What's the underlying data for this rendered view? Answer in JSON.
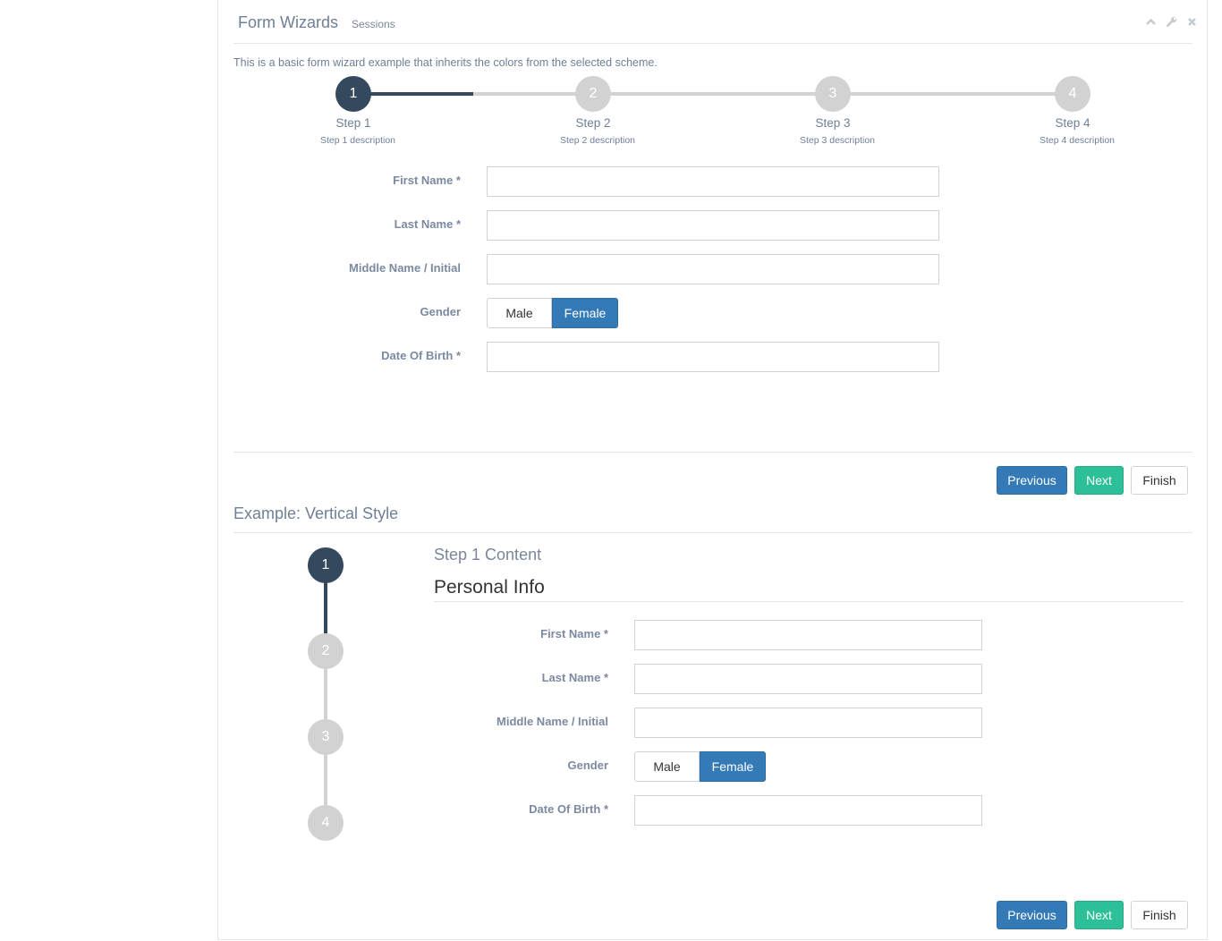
{
  "header": {
    "title": "Form Wizards",
    "subtitle": "Sessions",
    "icons": [
      "chevron-up-icon",
      "wrench-icon",
      "close-icon"
    ]
  },
  "description": "This is a basic form wizard example that inherits the colors from the selected scheme.",
  "wizard_horizontal": {
    "steps": [
      {
        "number": "1",
        "title": "Step 1",
        "description": "Step 1 description",
        "active": true
      },
      {
        "number": "2",
        "title": "Step 2",
        "description": "Step 2 description",
        "active": false
      },
      {
        "number": "3",
        "title": "Step 3",
        "description": "Step 3 description",
        "active": false
      },
      {
        "number": "4",
        "title": "Step 4",
        "description": "Step 4 description",
        "active": false
      }
    ],
    "form": {
      "first_name_label": "First Name *",
      "first_name_value": "",
      "last_name_label": "Last Name *",
      "last_name_value": "",
      "middle_name_label": "Middle Name / Initial",
      "middle_name_value": "",
      "gender_label": "Gender",
      "gender_options": [
        "Male",
        "Female"
      ],
      "gender_selected": "Female",
      "dob_label": "Date Of Birth *",
      "dob_value": ""
    },
    "buttons": {
      "previous": "Previous",
      "next": "Next",
      "finish": "Finish"
    }
  },
  "wizard_vertical": {
    "section_title": "Example: Vertical Style",
    "steps": [
      {
        "number": "1",
        "active": true
      },
      {
        "number": "2",
        "active": false
      },
      {
        "number": "3",
        "active": false
      },
      {
        "number": "4",
        "active": false
      }
    ],
    "content_title": "Step 1 Content",
    "content_heading": "Personal Info",
    "form": {
      "first_name_label": "First Name *",
      "first_name_value": "",
      "last_name_label": "Last Name *",
      "last_name_value": "",
      "middle_name_label": "Middle Name / Initial",
      "middle_name_value": "",
      "gender_label": "Gender",
      "gender_options": [
        "Male",
        "Female"
      ],
      "gender_selected": "Female",
      "dob_label": "Date Of Birth *",
      "dob_value": ""
    },
    "buttons": {
      "previous": "Previous",
      "next": "Next",
      "finish": "Finish"
    }
  },
  "colors": {
    "active_step": "#34495e",
    "inactive_step": "#d2d2d2",
    "primary": "#337ab7",
    "success": "#2dbf98"
  }
}
